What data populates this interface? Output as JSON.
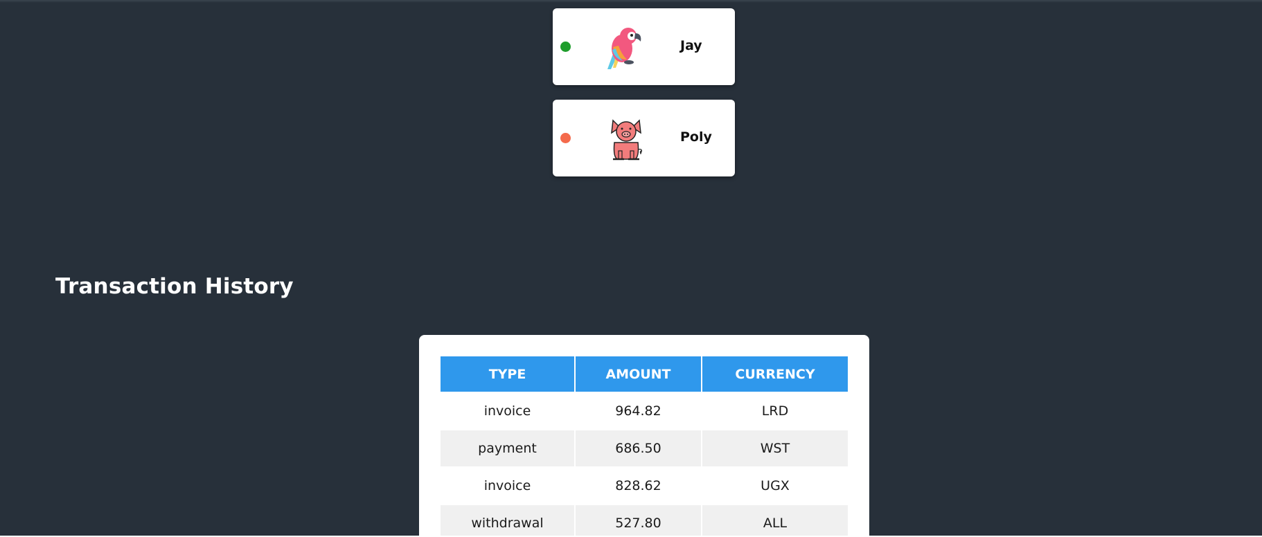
{
  "friends": [
    {
      "name": "Jay",
      "online": true,
      "status_color": "#1f9d2c",
      "avatar_icon": "parrot-icon"
    },
    {
      "name": "Poly",
      "online": false,
      "status_color": "#f46a4b",
      "avatar_icon": "pig-icon"
    }
  ],
  "transactions": {
    "title": "Transaction History",
    "headers": [
      "TYPE",
      "AMOUNT",
      "CURRENCY"
    ],
    "rows": [
      {
        "type": "invoice",
        "amount": "964.82",
        "currency": "LRD"
      },
      {
        "type": "payment",
        "amount": "686.50",
        "currency": "WST"
      },
      {
        "type": "invoice",
        "amount": "828.62",
        "currency": "UGX"
      },
      {
        "type": "withdrawal",
        "amount": "527.80",
        "currency": "ALL"
      }
    ]
  },
  "colors": {
    "background": "#27303a",
    "header_blue": "#2f98ec",
    "online": "#1f9d2c",
    "offline": "#f46a4b"
  }
}
